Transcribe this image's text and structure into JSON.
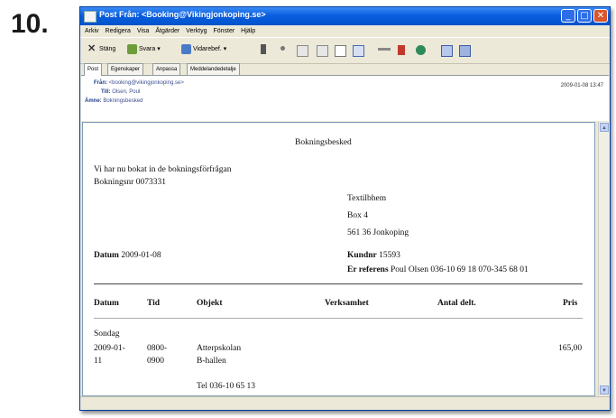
{
  "step_label": "10.",
  "window": {
    "title": "Post Från: <Booking@Vikingjonkoping.se>",
    "minimize_glyph": "_",
    "maximize_glyph": "□",
    "close_glyph": "✕"
  },
  "menu": [
    "Arkiv",
    "Redigera",
    "Visa",
    "Åtgärder",
    "Verktyg",
    "Fönster",
    "Hjälp"
  ],
  "toolbar": {
    "close_label": "Stäng",
    "reply_label": "Svara",
    "forward_label": "Vidarebef."
  },
  "tabs": [
    "Post",
    "Egenskaper",
    "Anpassa",
    "Meddelandedetalje"
  ],
  "header": {
    "from_label": "Från:",
    "from_value": "<booking@vikingjonkoping.se>",
    "to_label": "Till:",
    "to_value": "Olsen, Poul",
    "subject_label": "Ämne:",
    "subject_value": "Bokningsbesked",
    "date": "2009-01-08 13:47"
  },
  "doc": {
    "title": "Bokningsbesked",
    "intro": "Vi har nu bokat in de bokningsförfrågan",
    "booking_label": "Bokningsnr",
    "booking_no": "0073331",
    "addr1": "Textilbhem",
    "addr2": "Box 4",
    "addr3": "561 36 Jonkoping",
    "datum_label": "Datum",
    "datum_value": "2009-01-08",
    "kund_label": "Kundnr",
    "kund_value": "15593",
    "ref_label": "Er referens",
    "ref_value": "Poul Olsen 036-10 69 18 070-345 68 01",
    "cols": [
      "Datum",
      "Tid",
      "Objekt",
      "Verksamhet",
      "Antal delt.",
      "Pris"
    ],
    "day": "Sondag",
    "row_date_1": "2009-01-",
    "row_date_2": "11",
    "row_time_1": "0800-",
    "row_time_2": "0900",
    "row_obj_1": "Atterpskolan",
    "row_obj_2": "B-hallen",
    "row_price": "165,00",
    "phone": "Tel 036-10 65 13"
  },
  "colors": {
    "title_blue": "#0a5ede",
    "chrome": "#ece9d8",
    "close_red": "#d9562e"
  }
}
